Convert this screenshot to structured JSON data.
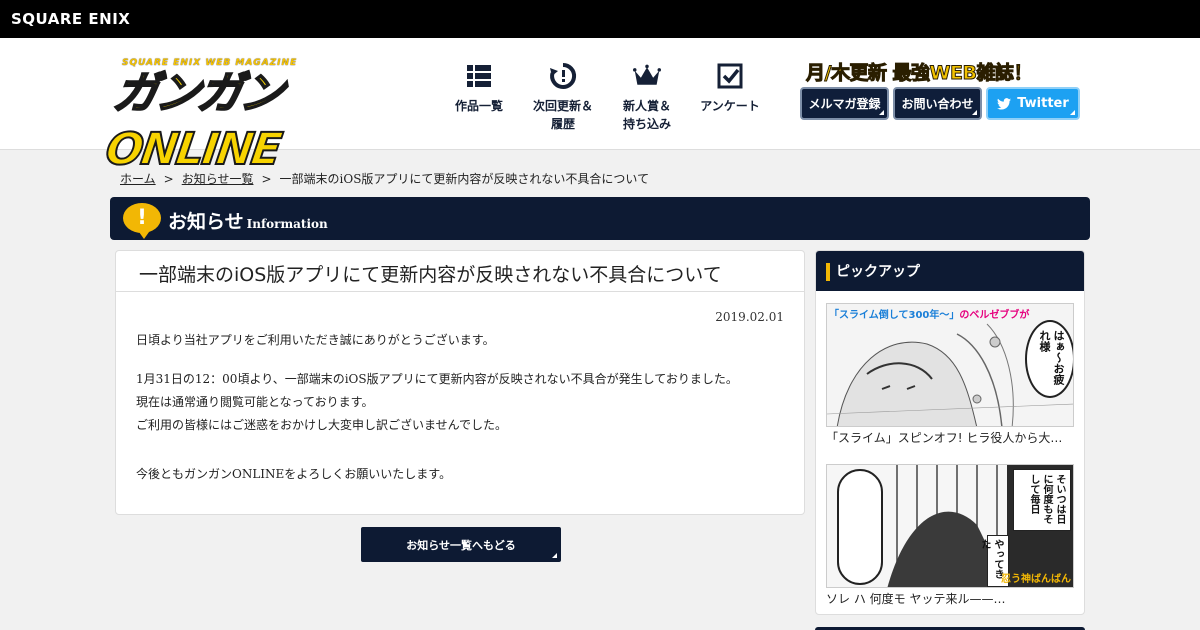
{
  "topbar": {
    "corp_logo": "SQUARE ENIX"
  },
  "header": {
    "logo_tag": "SQUARE ENIX WEB MAGAZINE",
    "logo_main": "ガンガンONLINE",
    "nav": [
      {
        "label": "作品一覧",
        "icon": "list-grid-icon"
      },
      {
        "label": "次回更新＆\n履歴",
        "icon": "clock-refresh-icon"
      },
      {
        "label": "新人賞＆\n持ち込み",
        "icon": "crown-icon"
      },
      {
        "label": "アンケート",
        "icon": "checkbox-icon"
      }
    ],
    "promo": "月/木更新 最強WEB雑誌！",
    "buttons": {
      "mail": "メルマガ登録",
      "contact": "お問い合わせ",
      "twitter": "Twitter"
    }
  },
  "breadcrumb": {
    "home": "ホーム",
    "sep": ">",
    "news": "お知らせ一覧",
    "current": "一部端末のiOS版アプリにて更新内容が反映されない不具合について"
  },
  "section": {
    "badge": "!",
    "title": "お知らせ",
    "subtitle": "Information"
  },
  "article": {
    "title": "一部端末のiOS版アプリにて更新内容が反映されない不具合について",
    "date": "2019.02.01",
    "p1": "日頃より当社アプリをご利用いただき誠にありがとうございます。",
    "p2": "1月31日の12：00頃より、一部端末のiOS版アプリにて更新内容が反映されない不具合が発生しておりました。",
    "p3": "現在は通常通り閲覧可能となっております。",
    "p4": "ご利用の皆様にはご迷惑をおかけし大変申し訳ございませんでした。",
    "p5": "今後ともガンガンONLINEをよろしくお願いいたします。"
  },
  "back_button": "お知らせ一覧へもどる",
  "sidebar": {
    "title": "ピックアップ",
    "items": [
      {
        "caption": "「スライム」スピンオフ! ヒラ役人から大臣…",
        "overlay_a": "「スライム倒して300年～」",
        "overlay_b": "のベルゼブブが",
        "speech": "はぁ～お疲れ様"
      },
      {
        "caption": "ソレ ハ 何度モ ヤッテ来ル——…",
        "speech_a": "そいつは日に何度もそして毎日",
        "speech_b": "やってきた",
        "signature": "忍う神ばんばん"
      }
    ]
  },
  "colors": {
    "navy": "#0d1a33",
    "yellow": "#f2b705",
    "twitter": "#1da1f2"
  }
}
